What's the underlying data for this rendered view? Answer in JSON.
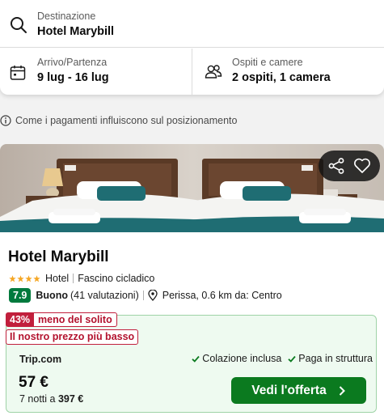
{
  "search": {
    "destination": {
      "label": "Destinazione",
      "value": "Hotel Marybill",
      "icon": "search-icon"
    },
    "dates": {
      "label": "Arrivo/Partenza",
      "value": "9 lug - 16 lug",
      "icon": "calendar-icon"
    },
    "guests": {
      "label": "Ospiti e camere",
      "value": "2 ospiti, 1 camera",
      "icon": "guests-icon"
    }
  },
  "info": {
    "text": "Come i pagamenti influiscono sul posizionamento",
    "icon": "info-icon"
  },
  "image_actions": {
    "share_icon": "share-icon",
    "favorite_icon": "heart-icon"
  },
  "hotel": {
    "name": "Hotel Marybill",
    "stars": 4,
    "type": "Hotel",
    "tag": "Fascino cicladico",
    "rating": "7.9",
    "rating_word": "Buono",
    "reviews": "(41 valutazioni)",
    "location": "Perissa, 0.6 km da: Centro"
  },
  "offer": {
    "discount_pct": "43%",
    "discount_text": "meno del solito",
    "lowest_text": "Il nostro prezzo più basso",
    "provider": "Trip.com",
    "amenities": [
      "Colazione inclusa",
      "Paga in struttura"
    ],
    "price": "57 €",
    "total_prefix": "7 notti a",
    "total_amount": "397 €",
    "cta_label": "Vedi l'offerta"
  },
  "colors": {
    "rating_green": "#007a3d",
    "cta_green": "#0b7a1f",
    "deal_red": "#c11f3c",
    "offer_bg": "#eefaf0",
    "star_gold": "#f5a623"
  }
}
